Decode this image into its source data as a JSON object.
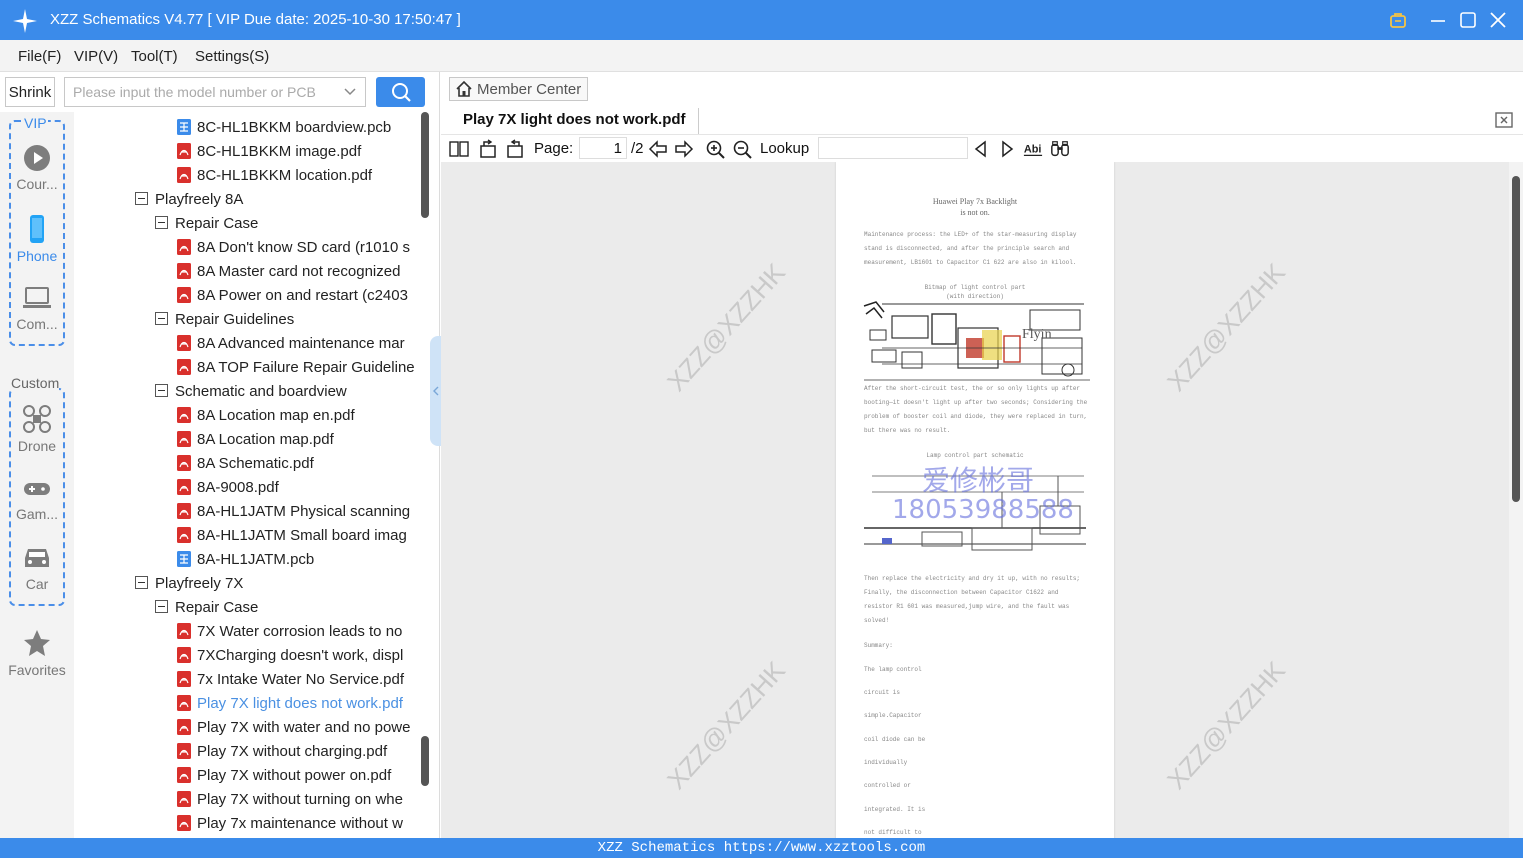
{
  "window": {
    "title": "XZZ Schematics V4.77 [ VIP Due date: 2025-10-30 17:50:47 ]"
  },
  "menu": [
    "File(F)",
    "VIP(V)",
    "Tool(T)",
    "Settings(S)"
  ],
  "left": {
    "shrink_label": "Shrink",
    "search_placeholder": "Please input the model number or PCB",
    "vip_label": "VIP",
    "custom_label": "Custom",
    "categories": {
      "courses": "Cour...",
      "phone": "Phone",
      "computer": "Com...",
      "drone": "Drone",
      "game": "Gam...",
      "car": "Car",
      "favorites": "Favorites"
    },
    "tree": [
      {
        "text": "8C-HL1BKKM boardview.pcb",
        "level": 3,
        "icon": "pcb-file-icon"
      },
      {
        "text": "8C-HL1BKKM image.pdf",
        "level": 3,
        "icon": "pdf-file-icon"
      },
      {
        "text": "8C-HL1BKKM location.pdf",
        "level": 3,
        "icon": "pdf-file-icon"
      },
      {
        "text": "Playfreely 8A",
        "level": 1,
        "icon": "folder"
      },
      {
        "text": "Repair Case",
        "level": 2,
        "icon": "folder"
      },
      {
        "text": "8A Don't know SD card (r1010 s",
        "level": 3,
        "icon": "pdf-file-icon"
      },
      {
        "text": "8A Master card not recognized",
        "level": 3,
        "icon": "pdf-file-icon"
      },
      {
        "text": "8A Power on and restart (c2403",
        "level": 3,
        "icon": "pdf-file-icon"
      },
      {
        "text": "Repair Guidelines",
        "level": 2,
        "icon": "folder"
      },
      {
        "text": "8A Advanced maintenance mar",
        "level": 3,
        "icon": "pdf-file-icon"
      },
      {
        "text": "8A TOP Failure Repair Guideline",
        "level": 3,
        "icon": "pdf-file-icon"
      },
      {
        "text": "Schematic and boardview",
        "level": 2,
        "icon": "folder"
      },
      {
        "text": "8A Location map en.pdf",
        "level": 3,
        "icon": "pdf-file-icon"
      },
      {
        "text": "8A Location map.pdf",
        "level": 3,
        "icon": "pdf-file-icon"
      },
      {
        "text": "8A Schematic.pdf",
        "level": 3,
        "icon": "pdf-file-icon"
      },
      {
        "text": "8A-9008.pdf",
        "level": 3,
        "icon": "pdf-file-icon"
      },
      {
        "text": "8A-HL1JATM Physical scanning",
        "level": 3,
        "icon": "pdf-file-icon"
      },
      {
        "text": "8A-HL1JATM Small board imag",
        "level": 3,
        "icon": "pdf-file-icon"
      },
      {
        "text": "8A-HL1JATM.pcb",
        "level": 3,
        "icon": "pcb-file-icon"
      },
      {
        "text": "Playfreely 7X",
        "level": 1,
        "icon": "folder"
      },
      {
        "text": "Repair Case",
        "level": 2,
        "icon": "folder"
      },
      {
        "text": "7X Water corrosion leads to no",
        "level": 3,
        "icon": "pdf-file-icon"
      },
      {
        "text": "7XCharging doesn't work, displ",
        "level": 3,
        "icon": "pdf-file-icon"
      },
      {
        "text": "7x Intake Water No Service.pdf",
        "level": 3,
        "icon": "pdf-file-icon"
      },
      {
        "text": "Play 7X light does not work.pdf",
        "level": 3,
        "icon": "pdf-file-icon",
        "selected": true
      },
      {
        "text": "Play 7X with water and no powe",
        "level": 3,
        "icon": "pdf-file-icon"
      },
      {
        "text": "Play 7X without charging.pdf",
        "level": 3,
        "icon": "pdf-file-icon"
      },
      {
        "text": "Play 7X without power on.pdf",
        "level": 3,
        "icon": "pdf-file-icon"
      },
      {
        "text": "Play 7X without turning on whe",
        "level": 3,
        "icon": "pdf-file-icon"
      },
      {
        "text": "Play 7x maintenance without w",
        "level": 3,
        "icon": "pdf-file-icon"
      }
    ]
  },
  "content": {
    "member_center": "Member Center",
    "open_tab": "Play 7X light does not work.pdf",
    "toolbar": {
      "page_label": "Page:",
      "page_value": "1",
      "page_total": "/2",
      "lookup_label": "Lookup",
      "lookup_value": ""
    },
    "watermark_text": "XZZ@XZZHK",
    "pdf": {
      "title_line1": "Huawei Play 7x Backlight",
      "title_line2": "is not on.",
      "para1": "Maintenance process: the LED+ of the star-measuring display stand is disconnected, and after the principle search and measurement, LB1601 to Capacitor C1 622 are also in kilool.",
      "cap1_line1": "Bitmap of light control part",
      "cap1_line2": "(with direction)",
      "para2": "After the short-circuit test, the or so only lights up after booting—it doesn't light up after two seconds; Considering the problem of booster coil and diode, they were replaced in turn, but there was no result.",
      "cap2": "Lamp control part schematic",
      "zh_watermark": "爱修彬哥",
      "phone_watermark": "18053988588",
      "para3": "Then replace the electricity and dry it up, with no results; Finally, the disconnection between Capacitor C1622 and resistor R1 601 was measured,jump wire, and the fault was solved!",
      "summary": "Summary:",
      "summary_lines": [
        "The lamp control",
        "circuit is",
        "simple.Capacitor",
        "coil diode can be",
        "individually",
        "controlled or",
        "integrated. It is",
        "not difficult to"
      ],
      "flyin_label": "Flyin"
    }
  },
  "status_bar": "XZZ Schematics https://www.xzztools.com",
  "colors": {
    "brand_blue": "#3b8bea",
    "pdf_red": "#d9302c",
    "selected_text": "#4a90e2"
  }
}
